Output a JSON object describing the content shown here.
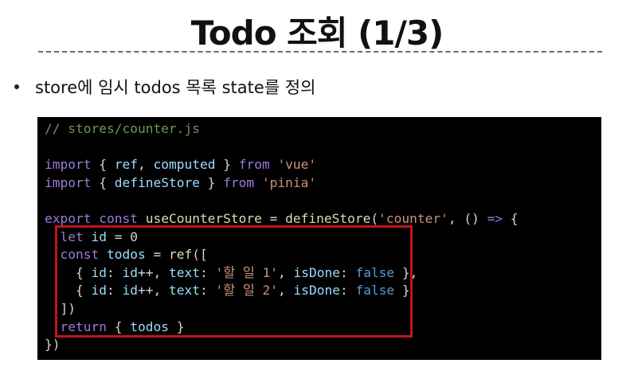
{
  "slide": {
    "title": "Todo 조회 (1/3)",
    "bullet": "store에 임시 todos 목록 state를 정의"
  },
  "code": {
    "lines": [
      [
        {
          "t": "// stores/counter.js",
          "c": "comment"
        }
      ],
      [],
      [
        {
          "t": "import",
          "c": "kw"
        },
        {
          "t": " { ",
          "c": "plain"
        },
        {
          "t": "ref",
          "c": "ident"
        },
        {
          "t": ", ",
          "c": "plain"
        },
        {
          "t": "computed",
          "c": "ident"
        },
        {
          "t": " } ",
          "c": "plain"
        },
        {
          "t": "from",
          "c": "kw"
        },
        {
          "t": " ",
          "c": "plain"
        },
        {
          "t": "'vue'",
          "c": "str"
        }
      ],
      [
        {
          "t": "import",
          "c": "kw"
        },
        {
          "t": " { ",
          "c": "plain"
        },
        {
          "t": "defineStore",
          "c": "ident"
        },
        {
          "t": " } ",
          "c": "plain"
        },
        {
          "t": "from",
          "c": "kw"
        },
        {
          "t": " ",
          "c": "plain"
        },
        {
          "t": "'pinia'",
          "c": "str"
        }
      ],
      [],
      [
        {
          "t": "export",
          "c": "kw"
        },
        {
          "t": " ",
          "c": "plain"
        },
        {
          "t": "const",
          "c": "kw"
        },
        {
          "t": " ",
          "c": "plain"
        },
        {
          "t": "useCounterStore",
          "c": "fn"
        },
        {
          "t": " = ",
          "c": "plain"
        },
        {
          "t": "defineStore",
          "c": "fn"
        },
        {
          "t": "(",
          "c": "plain"
        },
        {
          "t": "'counter'",
          "c": "str"
        },
        {
          "t": ", () ",
          "c": "plain"
        },
        {
          "t": "=>",
          "c": "kw"
        },
        {
          "t": " {",
          "c": "plain"
        }
      ],
      [
        {
          "t": "  ",
          "c": "plain"
        },
        {
          "t": "let",
          "c": "kw"
        },
        {
          "t": " ",
          "c": "plain"
        },
        {
          "t": "id",
          "c": "ident"
        },
        {
          "t": " = ",
          "c": "plain"
        },
        {
          "t": "0",
          "c": "plain"
        }
      ],
      [
        {
          "t": "  ",
          "c": "plain"
        },
        {
          "t": "const",
          "c": "kw"
        },
        {
          "t": " ",
          "c": "plain"
        },
        {
          "t": "todos",
          "c": "ident"
        },
        {
          "t": " = ",
          "c": "plain"
        },
        {
          "t": "ref",
          "c": "fn"
        },
        {
          "t": "([",
          "c": "plain"
        }
      ],
      [
        {
          "t": "    { ",
          "c": "plain"
        },
        {
          "t": "id",
          "c": "ident"
        },
        {
          "t": ": ",
          "c": "plain"
        },
        {
          "t": "id",
          "c": "ident"
        },
        {
          "t": "++, ",
          "c": "plain"
        },
        {
          "t": "text",
          "c": "ident"
        },
        {
          "t": ": ",
          "c": "plain"
        },
        {
          "t": "'할 일 1'",
          "c": "str"
        },
        {
          "t": ", ",
          "c": "plain"
        },
        {
          "t": "isDone",
          "c": "ident"
        },
        {
          "t": ": ",
          "c": "plain"
        },
        {
          "t": "false",
          "c": "bool"
        },
        {
          "t": " },",
          "c": "plain"
        }
      ],
      [
        {
          "t": "    { ",
          "c": "plain"
        },
        {
          "t": "id",
          "c": "ident"
        },
        {
          "t": ": ",
          "c": "plain"
        },
        {
          "t": "id",
          "c": "ident"
        },
        {
          "t": "++, ",
          "c": "plain"
        },
        {
          "t": "text",
          "c": "ident"
        },
        {
          "t": ": ",
          "c": "plain"
        },
        {
          "t": "'할 일 2'",
          "c": "str"
        },
        {
          "t": ", ",
          "c": "plain"
        },
        {
          "t": "isDone",
          "c": "ident"
        },
        {
          "t": ": ",
          "c": "plain"
        },
        {
          "t": "false",
          "c": "bool"
        },
        {
          "t": " }",
          "c": "plain"
        }
      ],
      [
        {
          "t": "  ])",
          "c": "plain"
        }
      ],
      [
        {
          "t": "  ",
          "c": "plain"
        },
        {
          "t": "return",
          "c": "kw"
        },
        {
          "t": " { ",
          "c": "plain"
        },
        {
          "t": "todos",
          "c": "ident"
        },
        {
          "t": " }",
          "c": "plain"
        }
      ],
      [
        {
          "t": "})",
          "c": "plain"
        }
      ]
    ]
  },
  "colors": {
    "highlight_border": "#c0141c",
    "code_background": "#000000"
  }
}
